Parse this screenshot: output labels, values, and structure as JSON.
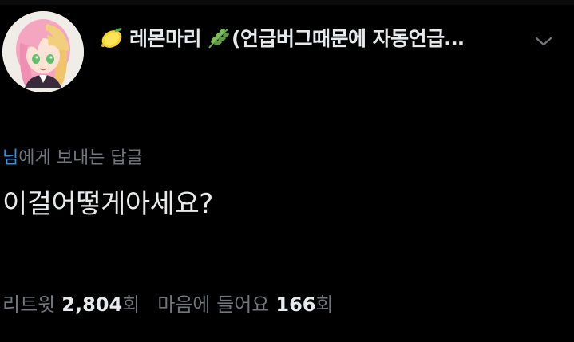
{
  "author": {
    "display_name": "레몬마리",
    "display_suffix": "(언급버그때문에 자동언급…",
    "lead_icon": "lemon-icon",
    "trail_icon": "herb-icon"
  },
  "more_icon": "chevron-down-icon",
  "reply": {
    "mention": "님",
    "label": "에게 보내는 답글"
  },
  "tweet": {
    "text": "이걸어떻게아세요?"
  },
  "stats": {
    "retweet_label": "리트윗",
    "retweet_count": "2,804",
    "retweet_unit": "회",
    "like_label": "마음에 들어요",
    "like_count": "166",
    "like_unit": "회"
  },
  "colors": {
    "background": "#000000",
    "text": "#e7e9ea",
    "muted": "#71767b",
    "mention": "#1d9bf0"
  }
}
